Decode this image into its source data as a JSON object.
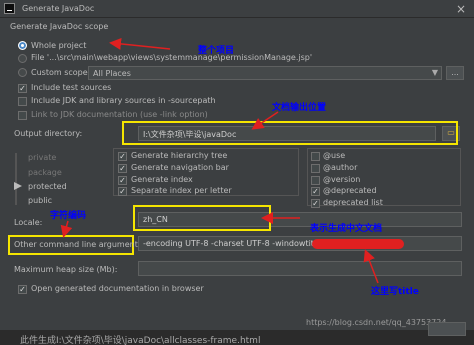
{
  "window": {
    "title": "Generate JavaDoc",
    "close_glyph": "×"
  },
  "scope": {
    "heading": "Generate JavaDoc scope",
    "whole_project": "Whole project",
    "file": "File '...\\src\\main\\webapp\\views\\systemmanage\\permissionManage.jsp'",
    "custom_scope": "Custom scope",
    "custom_scope_value": "All Places",
    "more_button": "..."
  },
  "options": {
    "include_test_sources": "Include test sources",
    "include_jdk": "Include JDK and library sources in -sourcepath",
    "link_jdk": "Link to JDK documentation (use -link option)"
  },
  "output": {
    "label": "Output directory:",
    "value": "I:\\文件杂项\\毕设\\javaDoc"
  },
  "visibility": [
    "private",
    "package",
    "protected",
    "public"
  ],
  "generate": [
    "Generate hierarchy tree",
    "Generate navigation bar",
    "Generate index",
    "Separate index per letter"
  ],
  "tags": [
    "@use",
    "@author",
    "@version",
    "@deprecated",
    "deprecated list"
  ],
  "locale": {
    "label": "Locale:",
    "value": "zh_CN"
  },
  "other_args": {
    "label": "Other command line arguments:",
    "value": "-encoding UTF-8 -charset UTF-8 -windowtitle \""
  },
  "heap": {
    "label": "Maximum heap size (Mb):"
  },
  "open_docs": "Open generated documentation in browser",
  "annotations": {
    "whole_project": "整个项目",
    "output_location": "文档输出位置",
    "encoding": "字符编码",
    "chinese_doc": "表示生成中文文档",
    "title_here": "这里写title"
  },
  "bottom": {
    "console": "此件生成I:\\文件杂项\\毕设\\javaDoc\\allclasses-frame.html",
    "watermark": "https://blog.csdn.net/qq_43753724"
  },
  "colors": {
    "annotation_blue": "#0000ff",
    "highlight_yellow": "#f5e500",
    "arrow_red": "#e02020",
    "selection_blue": "#4a88c7"
  }
}
